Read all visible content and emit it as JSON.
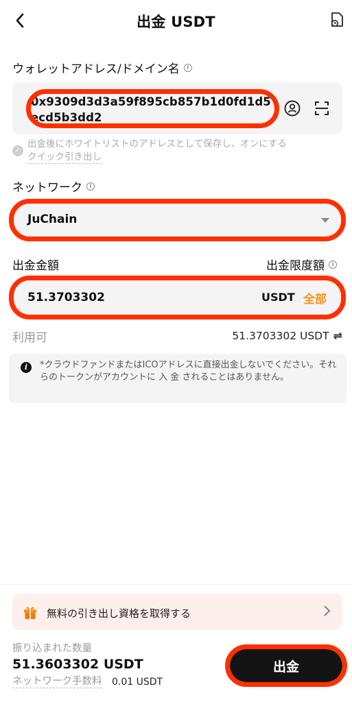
{
  "header": {
    "title": "出金 USDT",
    "back_icon": "chevron-left-icon",
    "history_icon": "document-clock-icon"
  },
  "address": {
    "label": "ウォレットアドレス/ドメイン名",
    "value": "0x9309d3d3a59f895cb857b1d0fd1d5ecd5b3dd2",
    "contact_icon": "person-circle-icon",
    "scan_icon": "scan-icon"
  },
  "whitelist": {
    "hint": "出金後にホワイトリストのアドレスとして保存し、オンにする",
    "link": "クイック引き出し"
  },
  "network": {
    "label": "ネットワーク",
    "value": "JuChain"
  },
  "amount": {
    "label": "出金金額",
    "limit_label": "出金限度額",
    "value": "51.3703302",
    "unit": "USDT",
    "all": "全部"
  },
  "available": {
    "label": "利用可",
    "value": "51.3703302 USDT"
  },
  "notice": {
    "text": "*クラウドファンドまたはICOアドレスに直接出金しないでください。それらのトークンがアカウントに 入 金 されることはありません。"
  },
  "promo": {
    "text": "無料の引き出し資格を取得する"
  },
  "footer": {
    "received_label": "振り込まれた数量",
    "received_value": "51.3603302 USDT",
    "fee_label": "ネットワーク手数料",
    "fee_value": "0.01 USDT",
    "submit": "出金"
  },
  "colors": {
    "accent": "#f7931e",
    "highlight": "#ff2f00",
    "button": "#141414"
  }
}
